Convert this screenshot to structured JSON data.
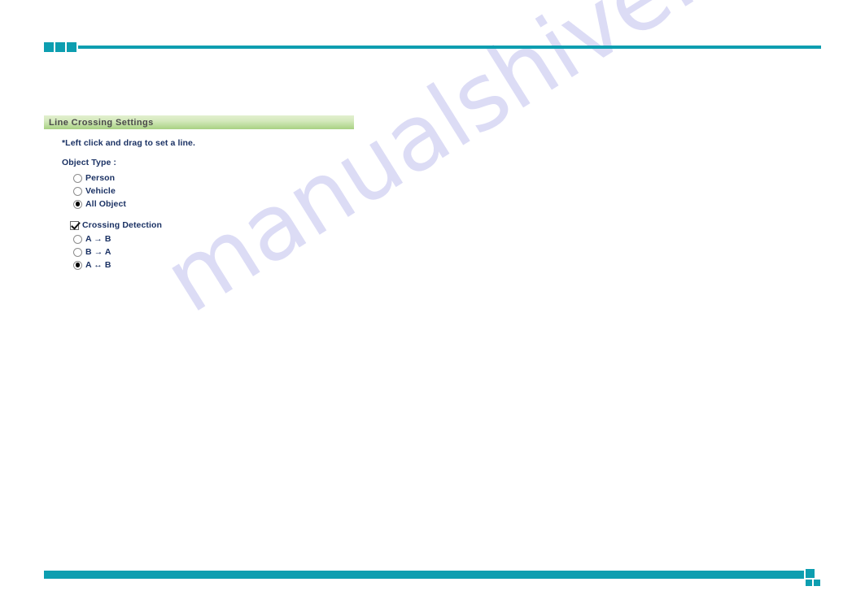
{
  "header": {
    "squares_count": 3,
    "accent_color": "#0d9eb0"
  },
  "watermark": {
    "text": "manualshive.com",
    "color": "#c8c8f0"
  },
  "section": {
    "title": "Line Crossing Settings",
    "gradient_from": "#e2f0cf",
    "gradient_to": "#a8d183",
    "title_color": "#4a4a4a"
  },
  "form": {
    "hint": "*Left click and drag to set a line.",
    "object_type": {
      "label": "Object Type :",
      "options": [
        {
          "label": "Person",
          "selected": false
        },
        {
          "label": "Vehicle",
          "selected": false
        },
        {
          "label": "All Object",
          "selected": true
        }
      ]
    },
    "crossing_detection": {
      "label": "Crossing Detection",
      "checked": true,
      "options": [
        {
          "label": "A → B",
          "selected": false
        },
        {
          "label": "B → A",
          "selected": false
        },
        {
          "label": "A ↔ B",
          "selected": true
        }
      ]
    },
    "text_color": "#1b3264"
  },
  "footer": {
    "accent_color": "#0d9eb0"
  }
}
